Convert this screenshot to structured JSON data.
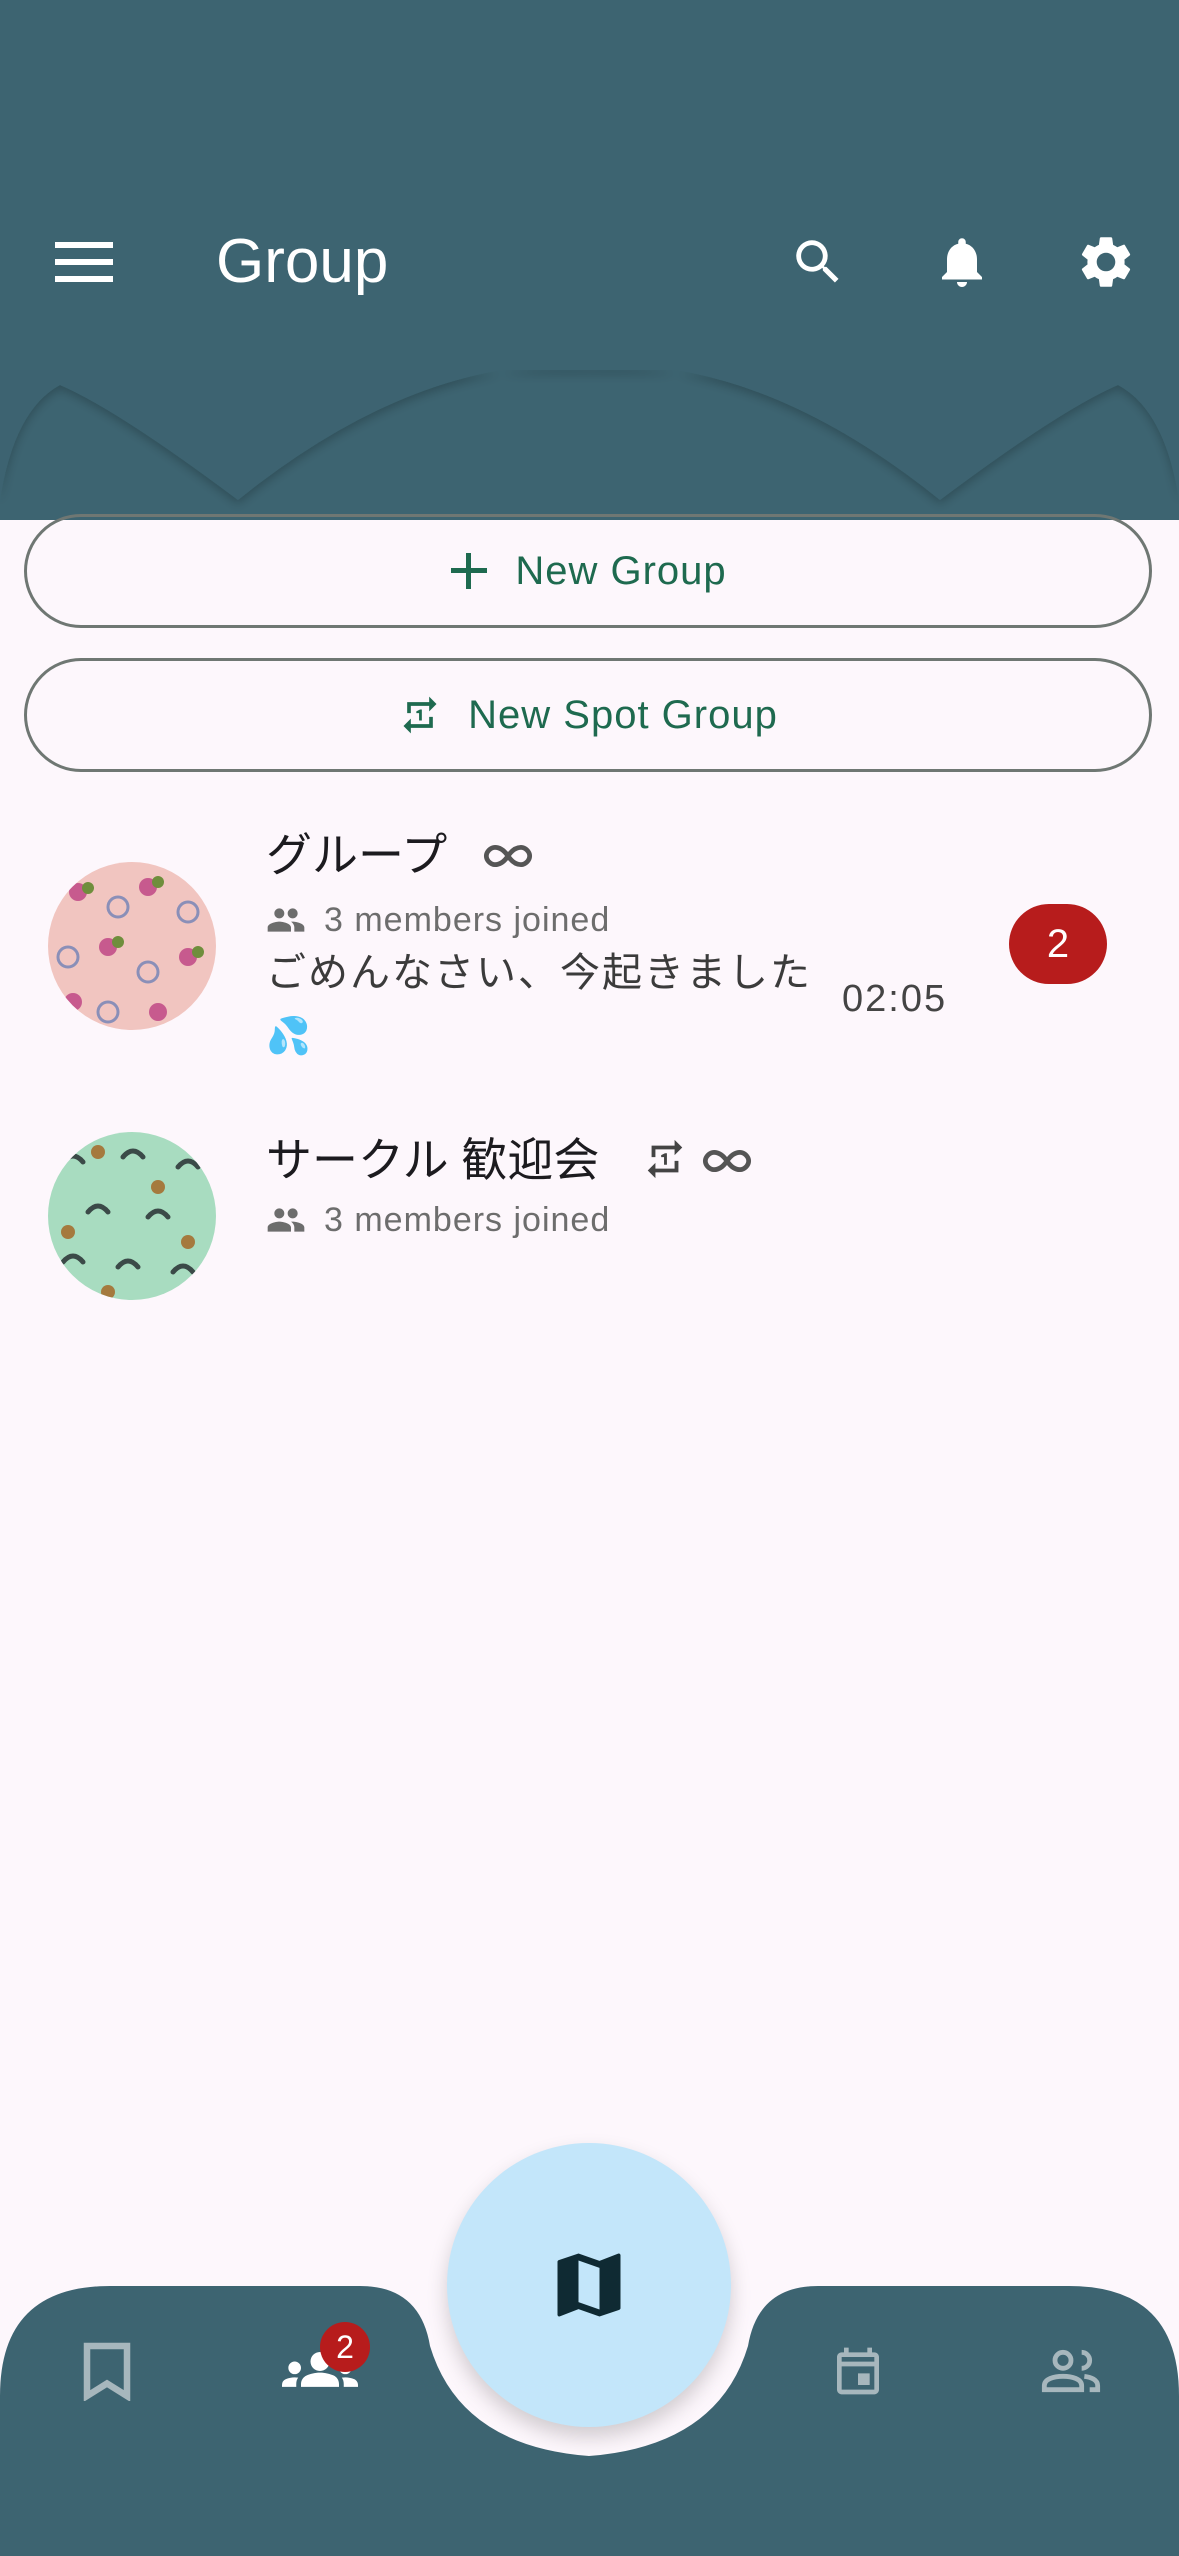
{
  "header": {
    "title": "Group",
    "menu_icon": "menu-icon",
    "search_icon": "search-icon",
    "bell_icon": "bell-icon",
    "settings_icon": "gear-icon",
    "background": "#3d6471"
  },
  "actions": {
    "new_group": {
      "label": "New Group",
      "icon": "plus-icon"
    },
    "new_spot_group": {
      "label": "New Spot Group",
      "icon": "repeat-one-icon"
    }
  },
  "groups": [
    {
      "name": "グループ",
      "members": "3 members joined",
      "last_message": "ごめんなさい、今起きました",
      "emoji": "💦",
      "time": "02:05",
      "unread": "2",
      "icons": [
        "infinity-icon"
      ],
      "avatar_color": "#f1c5c0"
    },
    {
      "name": "サークル 歓迎会",
      "members": "3 members joined",
      "icons": [
        "repeat-one-icon",
        "infinity-icon"
      ],
      "avatar_color": "#a8dcc0"
    }
  ],
  "bottom_nav": {
    "items": [
      "bookmark-icon",
      "group-icon",
      "calendar-icon",
      "people-icon"
    ],
    "group_badge": "2",
    "fab_icon": "map-icon",
    "background": "#3d6471"
  }
}
